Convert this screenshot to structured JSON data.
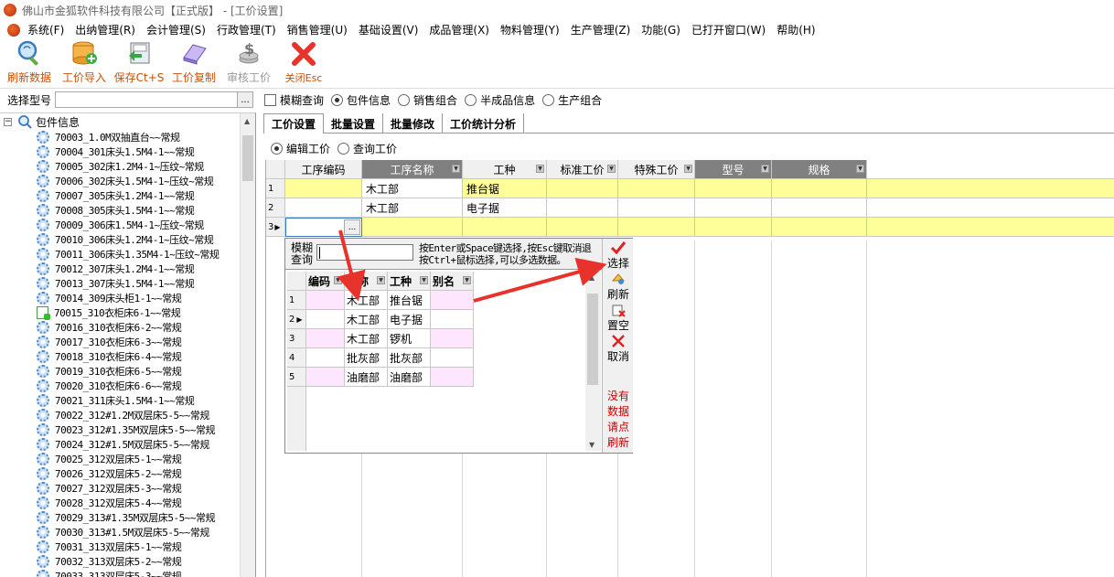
{
  "window": {
    "title": "佛山市金狐软件科技有限公司【正式版】 - [工价设置]"
  },
  "menu": [
    "系统(F)",
    "出纳管理(R)",
    "会计管理(S)",
    "行政管理(T)",
    "销售管理(U)",
    "基础设置(V)",
    "成品管理(X)",
    "物料管理(Y)",
    "生产管理(Z)",
    "功能(G)",
    "已打开窗口(W)",
    "帮助(H)"
  ],
  "toolbar": {
    "refresh": "刷新数据",
    "import": "工价导入",
    "save": "保存Ct+S",
    "copy": "工价复制",
    "audit": "审核工价",
    "close": "关闭Esc"
  },
  "filter": {
    "model_label": "选择型号",
    "model_value": "",
    "browse": "...",
    "fuzzy": "模糊查询",
    "opt_package": "包件信息",
    "opt_sales": "销售组合",
    "opt_semi": "半成品信息",
    "opt_production": "生产组合"
  },
  "tree": {
    "root": "包件信息",
    "items": [
      "70003_1.0M双抽直台~~常规",
      "70004_301床头1.5M4-1~~常规",
      "70005_302床1.2M4-1~压纹~常规",
      "70006_302床头1.5M4-1~压纹~常规",
      "70007_305床头1.2M4-1~~常规",
      "70008_305床头1.5M4-1~~常规",
      "70009_306床1.5M4-1~压纹~常规",
      "70010_306床头1.2M4-1~压纹~常规",
      "70011_306床头1.35M4-1~压纹~常规",
      "70012_307床头1.2M4-1~~常规",
      "70013_307床头1.5M4-1~~常规",
      "70014_309床头柜1-1~~常规",
      "70015_310衣柜床6-1~~常规",
      "70016_310衣柜床6-2~~常规",
      "70017_310衣柜床6-3~~常规",
      "70018_310衣柜床6-4~~常规",
      "70019_310衣柜床6-5~~常规",
      "70020_310衣柜床6-6~~常规",
      "70021_311床头1.5M4-1~~常规",
      "70022_312#1.2M双层床5-5~~常规",
      "70023_312#1.35M双层床5-5~~常规",
      "70024_312#1.5M双层床5-5~~常规",
      "70025_312双层床5-1~~常规",
      "70026_312双层床5-2~~常规",
      "70027_312双层床5-3~~常规",
      "70028_312双层床5-4~~常规",
      "70029_313#1.35M双层床5-5~~常规",
      "70030_313#1.5M双层床5-5~~常规",
      "70031_313双层床5-1~~常规",
      "70032_313双层床5-2~~常规",
      "70033_313双层床5-3~~常规"
    ]
  },
  "tabs": [
    "工价设置",
    "批量设置",
    "批量修改",
    "工价统计分析"
  ],
  "mode": {
    "edit": "编辑工价",
    "query": "查询工价"
  },
  "grid": {
    "headers": [
      "工序编码",
      "工序名称",
      "工种",
      "标准工价",
      "特殊工价",
      "型号",
      "规格"
    ],
    "rows": [
      {
        "idx": "1",
        "code": "",
        "name": "木工部",
        "type": "推台锯"
      },
      {
        "idx": "2",
        "code": "",
        "name": "木工部",
        "type": "电子据"
      },
      {
        "idx": "3",
        "code": "",
        "name": "",
        "type": ""
      }
    ],
    "cell_button": "..."
  },
  "popup": {
    "label": "模糊\n查询",
    "hint_line1": "按Enter或Space键选择,按Esc键取消退",
    "hint_line2": "按Ctrl+鼠标选择,可以多选数据。",
    "headers": [
      "编码",
      "名称",
      "工种",
      "别名"
    ],
    "rows": [
      {
        "idx": "1",
        "code": "",
        "name": "木工部",
        "type": "推台锯",
        "alias": ""
      },
      {
        "idx": "2",
        "code": "",
        "name": "木工部",
        "type": "电子据",
        "alias": ""
      },
      {
        "idx": "3",
        "code": "",
        "name": "木工部",
        "type": "锣机",
        "alias": ""
      },
      {
        "idx": "4",
        "code": "",
        "name": "批灰部",
        "type": "批灰部",
        "alias": ""
      },
      {
        "idx": "5",
        "code": "",
        "name": "油磨部",
        "type": "油磨部",
        "alias": ""
      }
    ],
    "side": {
      "select": "选择",
      "refresh": "刷新",
      "clear": "置空",
      "cancel": "取消",
      "nodata": [
        "没有",
        "数据",
        "请点",
        "刷新"
      ]
    }
  },
  "colors": {
    "accent_text": "#c8500a",
    "row_yellow": "#ffff99",
    "row_pink": "#ffe6ff",
    "arrow_red": "#e8322c"
  }
}
